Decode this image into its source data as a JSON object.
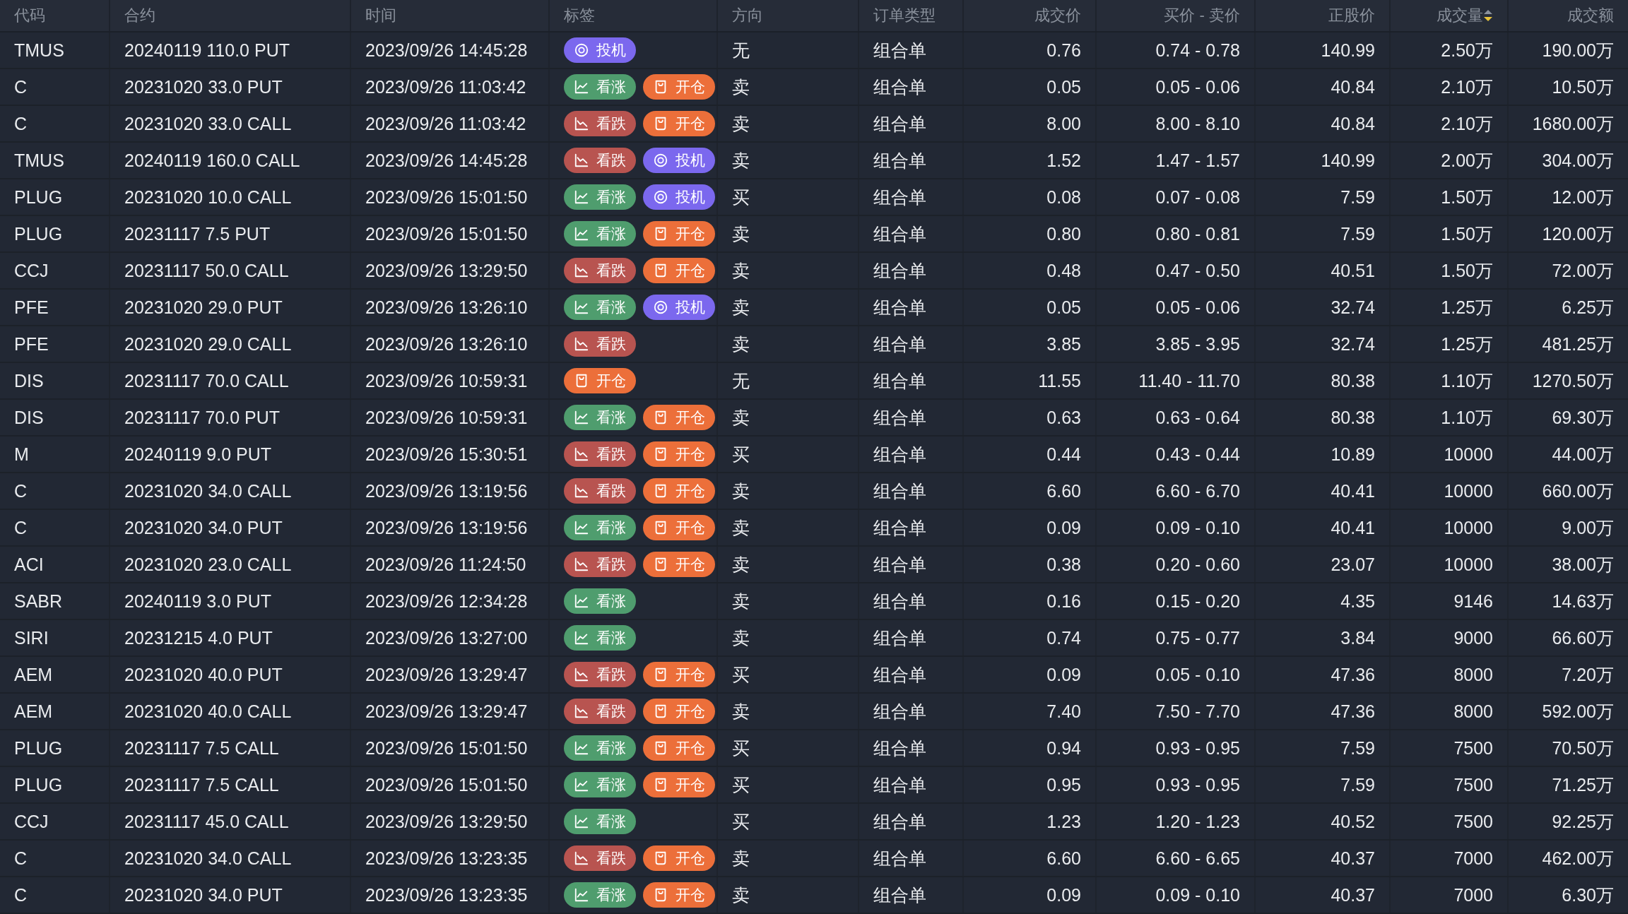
{
  "table": {
    "columns": [
      {
        "label": "代码",
        "sorted": false
      },
      {
        "label": "合约",
        "sorted": false
      },
      {
        "label": "时间",
        "sorted": false
      },
      {
        "label": "标签",
        "sorted": false
      },
      {
        "label": "方向",
        "sorted": false
      },
      {
        "label": "订单类型",
        "sorted": false
      },
      {
        "label": "成交价",
        "sorted": false
      },
      {
        "label": "买价 - 卖价",
        "sorted": false
      },
      {
        "label": "正股价",
        "sorted": false
      },
      {
        "label": "成交量",
        "sorted": true
      },
      {
        "label": "成交额",
        "sorted": false
      }
    ],
    "rows": [
      {
        "code": "TMUS",
        "contract": "20240119 110.0 PUT",
        "time": "2023/09/26 14:45:28",
        "tags": [
          {
            "kind": "speculate",
            "label": "投机"
          }
        ],
        "side": "无",
        "order_type": "组合单",
        "price": "0.76",
        "bid_ask": "0.74 - 0.78",
        "stock_price": "140.99",
        "volume": "2.50万",
        "amount": "190.00万"
      },
      {
        "code": "C",
        "contract": "20231020 33.0 PUT",
        "time": "2023/09/26 11:03:42",
        "tags": [
          {
            "kind": "bull",
            "label": "看涨"
          },
          {
            "kind": "open",
            "label": "开仓"
          }
        ],
        "side": "卖",
        "order_type": "组合单",
        "price": "0.05",
        "bid_ask": "0.05 - 0.06",
        "stock_price": "40.84",
        "volume": "2.10万",
        "amount": "10.50万"
      },
      {
        "code": "C",
        "contract": "20231020 33.0 CALL",
        "time": "2023/09/26 11:03:42",
        "tags": [
          {
            "kind": "bear",
            "label": "看跌"
          },
          {
            "kind": "open",
            "label": "开仓"
          }
        ],
        "side": "卖",
        "order_type": "组合单",
        "price": "8.00",
        "bid_ask": "8.00 - 8.10",
        "stock_price": "40.84",
        "volume": "2.10万",
        "amount": "1680.00万"
      },
      {
        "code": "TMUS",
        "contract": "20240119 160.0 CALL",
        "time": "2023/09/26 14:45:28",
        "tags": [
          {
            "kind": "bear",
            "label": "看跌"
          },
          {
            "kind": "speculate",
            "label": "投机"
          }
        ],
        "side": "卖",
        "order_type": "组合单",
        "price": "1.52",
        "bid_ask": "1.47 - 1.57",
        "stock_price": "140.99",
        "volume": "2.00万",
        "amount": "304.00万"
      },
      {
        "code": "PLUG",
        "contract": "20231020 10.0 CALL",
        "time": "2023/09/26 15:01:50",
        "tags": [
          {
            "kind": "bull",
            "label": "看涨"
          },
          {
            "kind": "speculate",
            "label": "投机"
          }
        ],
        "side": "买",
        "order_type": "组合单",
        "price": "0.08",
        "bid_ask": "0.07 - 0.08",
        "stock_price": "7.59",
        "volume": "1.50万",
        "amount": "12.00万"
      },
      {
        "code": "PLUG",
        "contract": "20231117 7.5 PUT",
        "time": "2023/09/26 15:01:50",
        "tags": [
          {
            "kind": "bull",
            "label": "看涨"
          },
          {
            "kind": "open",
            "label": "开仓"
          }
        ],
        "side": "卖",
        "order_type": "组合单",
        "price": "0.80",
        "bid_ask": "0.80 - 0.81",
        "stock_price": "7.59",
        "volume": "1.50万",
        "amount": "120.00万"
      },
      {
        "code": "CCJ",
        "contract": "20231117 50.0 CALL",
        "time": "2023/09/26 13:29:50",
        "tags": [
          {
            "kind": "bear",
            "label": "看跌"
          },
          {
            "kind": "open",
            "label": "开仓"
          }
        ],
        "side": "卖",
        "order_type": "组合单",
        "price": "0.48",
        "bid_ask": "0.47 - 0.50",
        "stock_price": "40.51",
        "volume": "1.50万",
        "amount": "72.00万"
      },
      {
        "code": "PFE",
        "contract": "20231020 29.0 PUT",
        "time": "2023/09/26 13:26:10",
        "tags": [
          {
            "kind": "bull",
            "label": "看涨"
          },
          {
            "kind": "speculate",
            "label": "投机"
          }
        ],
        "side": "卖",
        "order_type": "组合单",
        "price": "0.05",
        "bid_ask": "0.05 - 0.06",
        "stock_price": "32.74",
        "volume": "1.25万",
        "amount": "6.25万"
      },
      {
        "code": "PFE",
        "contract": "20231020 29.0 CALL",
        "time": "2023/09/26 13:26:10",
        "tags": [
          {
            "kind": "bear",
            "label": "看跌"
          }
        ],
        "side": "卖",
        "order_type": "组合单",
        "price": "3.85",
        "bid_ask": "3.85 - 3.95",
        "stock_price": "32.74",
        "volume": "1.25万",
        "amount": "481.25万"
      },
      {
        "code": "DIS",
        "contract": "20231117 70.0 CALL",
        "time": "2023/09/26 10:59:31",
        "tags": [
          {
            "kind": "open",
            "label": "开仓"
          }
        ],
        "side": "无",
        "order_type": "组合单",
        "price": "11.55",
        "bid_ask": "11.40 - 11.70",
        "stock_price": "80.38",
        "volume": "1.10万",
        "amount": "1270.50万"
      },
      {
        "code": "DIS",
        "contract": "20231117 70.0 PUT",
        "time": "2023/09/26 10:59:31",
        "tags": [
          {
            "kind": "bull",
            "label": "看涨"
          },
          {
            "kind": "open",
            "label": "开仓"
          }
        ],
        "side": "卖",
        "order_type": "组合单",
        "price": "0.63",
        "bid_ask": "0.63 - 0.64",
        "stock_price": "80.38",
        "volume": "1.10万",
        "amount": "69.30万"
      },
      {
        "code": "M",
        "contract": "20240119 9.0 PUT",
        "time": "2023/09/26 15:30:51",
        "tags": [
          {
            "kind": "bear",
            "label": "看跌"
          },
          {
            "kind": "open",
            "label": "开仓"
          }
        ],
        "side": "买",
        "order_type": "组合单",
        "price": "0.44",
        "bid_ask": "0.43 - 0.44",
        "stock_price": "10.89",
        "volume": "10000",
        "amount": "44.00万"
      },
      {
        "code": "C",
        "contract": "20231020 34.0 CALL",
        "time": "2023/09/26 13:19:56",
        "tags": [
          {
            "kind": "bear",
            "label": "看跌"
          },
          {
            "kind": "open",
            "label": "开仓"
          }
        ],
        "side": "卖",
        "order_type": "组合单",
        "price": "6.60",
        "bid_ask": "6.60 - 6.70",
        "stock_price": "40.41",
        "volume": "10000",
        "amount": "660.00万"
      },
      {
        "code": "C",
        "contract": "20231020 34.0 PUT",
        "time": "2023/09/26 13:19:56",
        "tags": [
          {
            "kind": "bull",
            "label": "看涨"
          },
          {
            "kind": "open",
            "label": "开仓"
          }
        ],
        "side": "卖",
        "order_type": "组合单",
        "price": "0.09",
        "bid_ask": "0.09 - 0.10",
        "stock_price": "40.41",
        "volume": "10000",
        "amount": "9.00万"
      },
      {
        "code": "ACI",
        "contract": "20231020 23.0 CALL",
        "time": "2023/09/26 11:24:50",
        "tags": [
          {
            "kind": "bear",
            "label": "看跌"
          },
          {
            "kind": "open",
            "label": "开仓"
          }
        ],
        "side": "卖",
        "order_type": "组合单",
        "price": "0.38",
        "bid_ask": "0.20 - 0.60",
        "stock_price": "23.07",
        "volume": "10000",
        "amount": "38.00万"
      },
      {
        "code": "SABR",
        "contract": "20240119 3.0 PUT",
        "time": "2023/09/26 12:34:28",
        "tags": [
          {
            "kind": "bull",
            "label": "看涨"
          }
        ],
        "side": "卖",
        "order_type": "组合单",
        "price": "0.16",
        "bid_ask": "0.15 - 0.20",
        "stock_price": "4.35",
        "volume": "9146",
        "amount": "14.63万"
      },
      {
        "code": "SIRI",
        "contract": "20231215 4.0 PUT",
        "time": "2023/09/26 13:27:00",
        "tags": [
          {
            "kind": "bull",
            "label": "看涨"
          }
        ],
        "side": "卖",
        "order_type": "组合单",
        "price": "0.74",
        "bid_ask": "0.75 - 0.77",
        "stock_price": "3.84",
        "volume": "9000",
        "amount": "66.60万"
      },
      {
        "code": "AEM",
        "contract": "20231020 40.0 PUT",
        "time": "2023/09/26 13:29:47",
        "tags": [
          {
            "kind": "bear",
            "label": "看跌"
          },
          {
            "kind": "open",
            "label": "开仓"
          }
        ],
        "side": "买",
        "order_type": "组合单",
        "price": "0.09",
        "bid_ask": "0.05 - 0.10",
        "stock_price": "47.36",
        "volume": "8000",
        "amount": "7.20万"
      },
      {
        "code": "AEM",
        "contract": "20231020 40.0 CALL",
        "time": "2023/09/26 13:29:47",
        "tags": [
          {
            "kind": "bear",
            "label": "看跌"
          },
          {
            "kind": "open",
            "label": "开仓"
          }
        ],
        "side": "卖",
        "order_type": "组合单",
        "price": "7.40",
        "bid_ask": "7.50 - 7.70",
        "stock_price": "47.36",
        "volume": "8000",
        "amount": "592.00万"
      },
      {
        "code": "PLUG",
        "contract": "20231117 7.5 CALL",
        "time": "2023/09/26 15:01:50",
        "tags": [
          {
            "kind": "bull",
            "label": "看涨"
          },
          {
            "kind": "open",
            "label": "开仓"
          }
        ],
        "side": "买",
        "order_type": "组合单",
        "price": "0.94",
        "bid_ask": "0.93 - 0.95",
        "stock_price": "7.59",
        "volume": "7500",
        "amount": "70.50万"
      },
      {
        "code": "PLUG",
        "contract": "20231117 7.5 CALL",
        "time": "2023/09/26 15:01:50",
        "tags": [
          {
            "kind": "bull",
            "label": "看涨"
          },
          {
            "kind": "open",
            "label": "开仓"
          }
        ],
        "side": "买",
        "order_type": "组合单",
        "price": "0.95",
        "bid_ask": "0.93 - 0.95",
        "stock_price": "7.59",
        "volume": "7500",
        "amount": "71.25万"
      },
      {
        "code": "CCJ",
        "contract": "20231117 45.0 CALL",
        "time": "2023/09/26 13:29:50",
        "tags": [
          {
            "kind": "bull",
            "label": "看涨"
          }
        ],
        "side": "买",
        "order_type": "组合单",
        "price": "1.23",
        "bid_ask": "1.20 - 1.23",
        "stock_price": "40.52",
        "volume": "7500",
        "amount": "92.25万"
      },
      {
        "code": "C",
        "contract": "20231020 34.0 CALL",
        "time": "2023/09/26 13:23:35",
        "tags": [
          {
            "kind": "bear",
            "label": "看跌"
          },
          {
            "kind": "open",
            "label": "开仓"
          }
        ],
        "side": "卖",
        "order_type": "组合单",
        "price": "6.60",
        "bid_ask": "6.60 - 6.65",
        "stock_price": "40.37",
        "volume": "7000",
        "amount": "462.00万"
      },
      {
        "code": "C",
        "contract": "20231020 34.0 PUT",
        "time": "2023/09/26 13:23:35",
        "tags": [
          {
            "kind": "bull",
            "label": "看涨"
          },
          {
            "kind": "open",
            "label": "开仓"
          }
        ],
        "side": "卖",
        "order_type": "组合单",
        "price": "0.09",
        "bid_ask": "0.09 - 0.10",
        "stock_price": "40.37",
        "volume": "7000",
        "amount": "6.30万"
      }
    ]
  }
}
